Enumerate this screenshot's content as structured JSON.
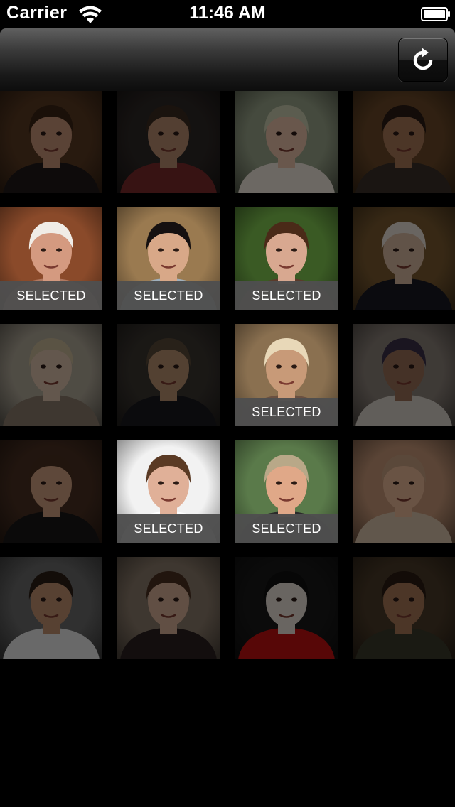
{
  "status_bar": {
    "carrier": "Carrier",
    "time": "11:46 AM",
    "wifi_icon": "wifi-icon",
    "battery_icon": "battery-full-icon"
  },
  "nav_bar": {
    "refresh_icon": "refresh-icon"
  },
  "selected_label": "SELECTED",
  "photos": [
    {
      "id": "photo-1",
      "subject": "woman-bangs",
      "selected": false,
      "bg": "#5a3a22",
      "skin": "#c89478",
      "hair": "#3b2414",
      "shirt": "#1f1a1a"
    },
    {
      "id": "photo-2",
      "subject": "man-sunglasses",
      "selected": false,
      "bg": "#2e2826",
      "skin": "#b98c70",
      "hair": "#3a2a20",
      "shirt": "#7a2a2a"
    },
    {
      "id": "photo-3",
      "subject": "baby-blanket",
      "selected": false,
      "bg": "#9aa58a",
      "skin": "#e8c0a8",
      "hair": "#c9ccb0",
      "shirt": "#f0e6dc"
    },
    {
      "id": "photo-4",
      "subject": "man-goatee",
      "selected": false,
      "bg": "#6a4828",
      "skin": "#a97858",
      "hair": "#2a1c14",
      "shirt": "#3a3028"
    },
    {
      "id": "photo-5",
      "subject": "woman-hat",
      "selected": true,
      "bg": "#8a4a2a",
      "skin": "#d49a80",
      "hair": "#f0ece6",
      "shirt": "#b07860"
    },
    {
      "id": "photo-6",
      "subject": "man-phone",
      "selected": true,
      "bg": "#9a7a50",
      "skin": "#d8a888",
      "hair": "#151010",
      "shirt": "#a0b0bc"
    },
    {
      "id": "photo-7",
      "subject": "woman-curly",
      "selected": true,
      "bg": "#3a5a24",
      "skin": "#d8a890",
      "hair": "#4a2a18",
      "shirt": "#5a3a2a"
    },
    {
      "id": "photo-8",
      "subject": "old-man-uniform",
      "selected": false,
      "bg": "#7a5a30",
      "skin": "#d8b8a0",
      "hair": "#e8e0d8",
      "shirt": "#1a1a22"
    },
    {
      "id": "photo-9",
      "subject": "woman-blonde",
      "selected": false,
      "bg": "#b0a898",
      "skin": "#dcc0aa",
      "hair": "#c8b898",
      "shirt": "#8a7a6a"
    },
    {
      "id": "photo-10",
      "subject": "man-suit",
      "selected": false,
      "bg": "#3a3530",
      "skin": "#b89070",
      "hair": "#5a4a38",
      "shirt": "#1a1a1e"
    },
    {
      "id": "photo-11",
      "subject": "old-woman-scarf",
      "selected": true,
      "bg": "#8a7050",
      "skin": "#c89a78",
      "hair": "#e8d8b8",
      "shirt": "#6a5040"
    },
    {
      "id": "photo-12",
      "subject": "old-man-cap",
      "selected": false,
      "bg": "#8a8078",
      "skin": "#9a7058",
      "hair": "#3a3048",
      "shirt": "#d8d0c8"
    },
    {
      "id": "photo-13",
      "subject": "man-glasses-point",
      "selected": false,
      "bg": "#4a3022",
      "skin": "#d0a080",
      "hair": "#4a3020",
      "shirt": "#1a1818"
    },
    {
      "id": "photo-14",
      "subject": "woman-yawn",
      "selected": true,
      "bg": "#f2f2f2",
      "skin": "#e0b098",
      "hair": "#5a3a24",
      "shirt": "#ffffff"
    },
    {
      "id": "photo-15",
      "subject": "man-sunglasses-off",
      "selected": true,
      "bg": "#5a7a4a",
      "skin": "#e0a888",
      "hair": "#b8a888",
      "shirt": "#2a2a2a"
    },
    {
      "id": "photo-16",
      "subject": "baby-smile",
      "selected": false,
      "bg": "#c89878",
      "skin": "#e8b898",
      "hair": "#c8a080",
      "shirt": "#d8c0a8"
    },
    {
      "id": "photo-17",
      "subject": "man-white-tee",
      "selected": false,
      "bg": "#6a6a6a",
      "skin": "#c09070",
      "hair": "#2a1e16",
      "shirt": "#e8e8e8"
    },
    {
      "id": "photo-18",
      "subject": "woman-hand-hair",
      "selected": false,
      "bg": "#8a7a6a",
      "skin": "#d8b098",
      "hair": "#4a3020",
      "shirt": "#2a2020"
    },
    {
      "id": "photo-19",
      "subject": "man-poster-red",
      "selected": false,
      "bg": "#1a1a1a",
      "skin": "#e8e0d8",
      "hair": "#111111",
      "shirt": "#c01010"
    },
    {
      "id": "photo-20",
      "subject": "man-beard-dark",
      "selected": false,
      "bg": "#4a3a28",
      "skin": "#a87858",
      "hair": "#2a1c12",
      "shirt": "#3a3a2a"
    }
  ]
}
